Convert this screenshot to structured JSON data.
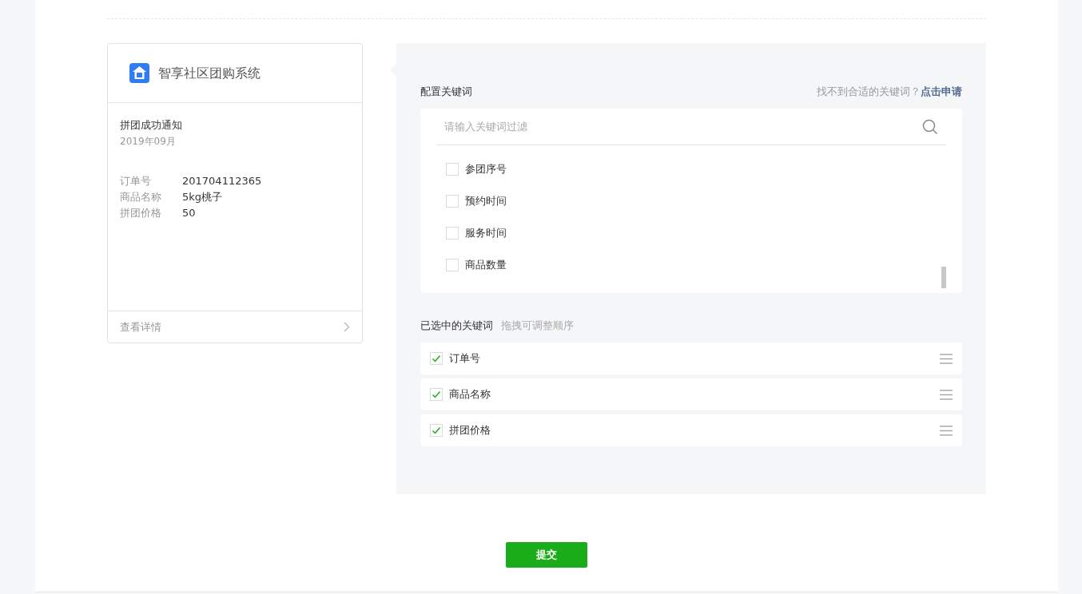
{
  "preview": {
    "app_name": "智享社区团购系统",
    "title": "拼团成功通知",
    "date": "2019年09月",
    "fields": [
      {
        "label": "订单号",
        "value": "201704112365"
      },
      {
        "label": "商品名称",
        "value": "5kg桃子"
      },
      {
        "label": "拼团价格",
        "value": "50"
      }
    ],
    "footer": "查看详情"
  },
  "keywords": {
    "title": "配置关键词",
    "hint": "找不到合适的关键词？",
    "apply_link": "点击申请",
    "search": {
      "placeholder": "请输入关键词过滤"
    },
    "options": [
      {
        "label": "参团序号",
        "checked": false
      },
      {
        "label": "预约时间",
        "checked": false
      },
      {
        "label": "服务时间",
        "checked": false
      },
      {
        "label": "商品数量",
        "checked": false
      }
    ]
  },
  "selected": {
    "title": "已选中的关键词",
    "hint": "拖拽可调整顺序",
    "items": [
      {
        "label": "订单号",
        "checked": true
      },
      {
        "label": "商品名称",
        "checked": true
      },
      {
        "label": "拼团价格",
        "checked": true
      }
    ]
  },
  "submit": "提交"
}
